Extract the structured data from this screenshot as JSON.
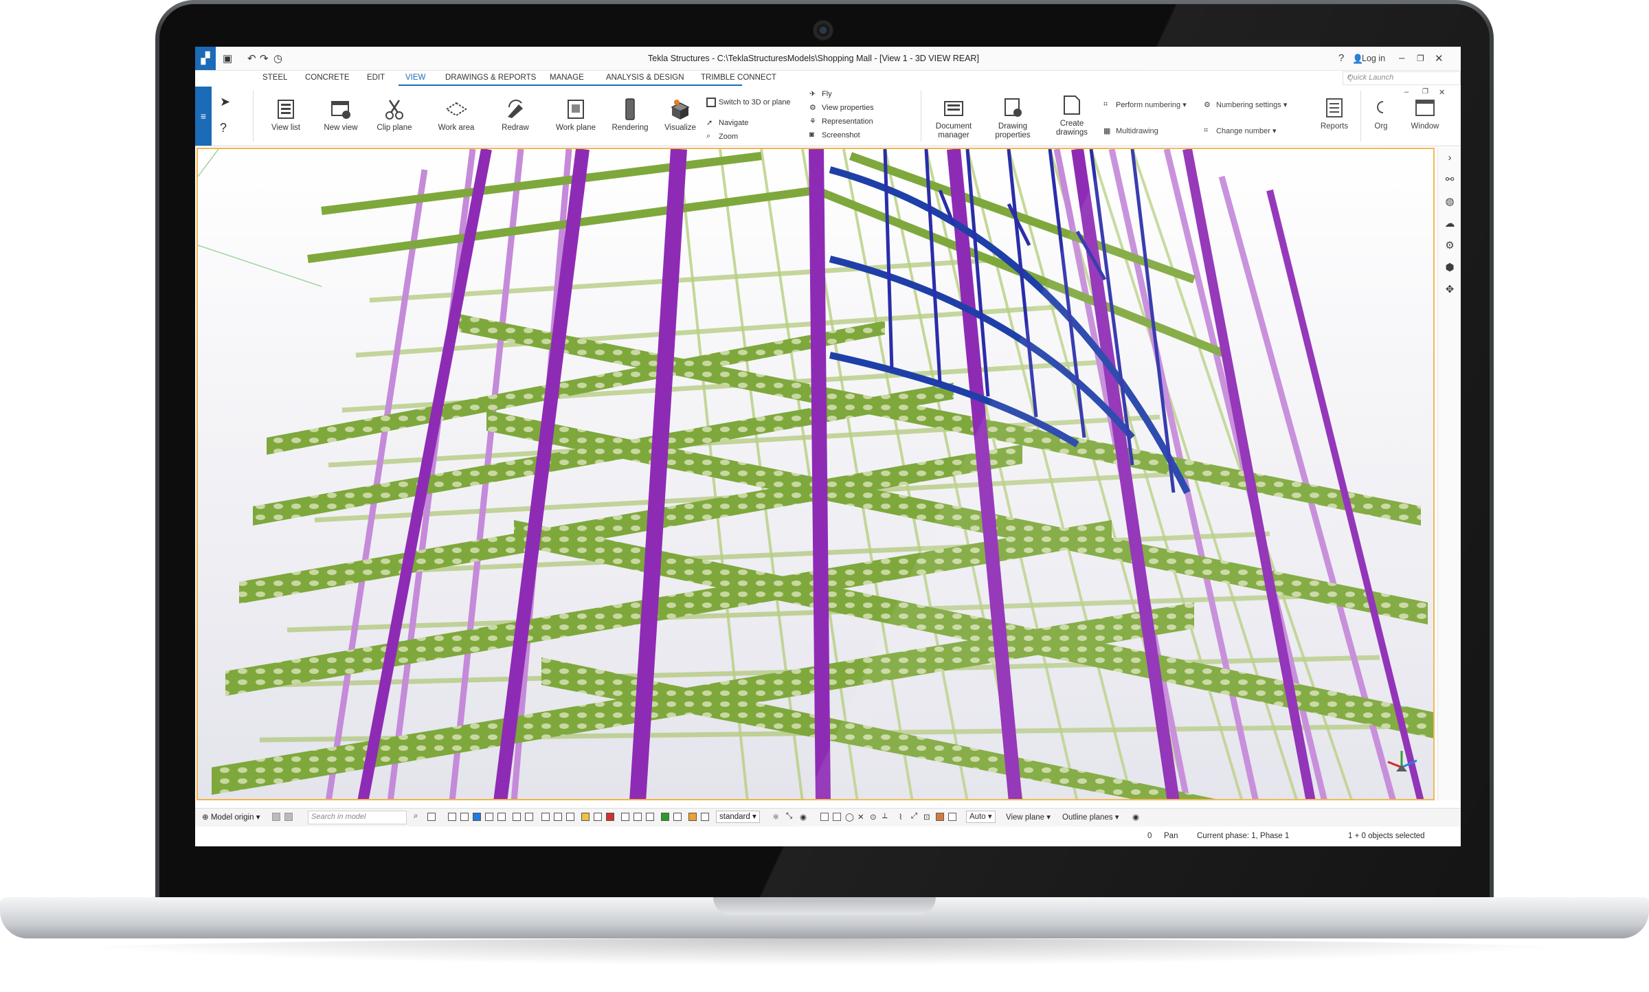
{
  "app": {
    "title": "Tekla Structures - C:\\TeklaStructuresModels\\Shopping Mall - [View 1 - 3D VIEW REAR]",
    "login_label": "Log in",
    "help_icon": "help-icon",
    "colors": {
      "accent": "#1b6bb7",
      "viewport_border": "#f2b54a",
      "beam_green": "#7ea83c",
      "column_purple": "#8e2bb5",
      "steel_blue": "#1f3fa8"
    }
  },
  "tabs": [
    {
      "label": "STEEL"
    },
    {
      "label": "CONCRETE"
    },
    {
      "label": "EDIT"
    },
    {
      "label": "VIEW",
      "active": true
    },
    {
      "label": "DRAWINGS & REPORTS"
    },
    {
      "label": "MANAGE"
    },
    {
      "label": "ANALYSIS & DESIGN"
    },
    {
      "label": "TRIMBLE CONNECT"
    }
  ],
  "quick_launch": {
    "placeholder": "Quick Launch"
  },
  "ribbon": {
    "large_buttons": [
      {
        "label": "View list",
        "icon": "view-list-icon"
      },
      {
        "label": "New view",
        "icon": "new-view-icon"
      },
      {
        "label": "Clip plane",
        "icon": "scissors-icon"
      },
      {
        "label": "Work area",
        "icon": "work-area-icon"
      },
      {
        "label": "Redraw",
        "icon": "redraw-icon"
      },
      {
        "label": "Work plane",
        "icon": "work-plane-icon"
      },
      {
        "label": "Rendering",
        "icon": "rendering-icon"
      },
      {
        "label": "Visualize",
        "icon": "visualize-icon"
      }
    ],
    "small_buttons": [
      {
        "label": "Switch to 3D or plane"
      },
      {
        "label": "Navigate"
      },
      {
        "label": "Zoom"
      },
      {
        "label": "Fly"
      },
      {
        "label": "View properties"
      },
      {
        "label": "Representation"
      },
      {
        "label": "Screenshot"
      }
    ],
    "drawing_buttons": [
      {
        "label": "Document manager"
      },
      {
        "label": "Drawing properties"
      },
      {
        "label": "Create drawings"
      }
    ],
    "numbering_buttons": [
      {
        "label": "Perform numbering"
      },
      {
        "label": "Multidrawing"
      },
      {
        "label": "Numbering settings"
      },
      {
        "label": "Change number"
      }
    ],
    "right_buttons": [
      {
        "label": "Reports"
      },
      {
        "label": "Org"
      },
      {
        "label": "Window"
      }
    ]
  },
  "right_toolbar_icons": [
    "chevron-right-icon",
    "link-icon",
    "globe-icon",
    "cloud-icon",
    "gear-icon",
    "cube-icon",
    "shapes-icon"
  ],
  "bottom_toolbar": {
    "model_origin": "Model origin",
    "search_placeholder": "Search in model",
    "standard": "standard",
    "auto": "Auto",
    "view_plane": "View plane",
    "outline_planes": "Outline planes"
  },
  "status_bar": {
    "value": "0",
    "mode": "Pan",
    "phase": "Current phase: 1, Phase 1",
    "selection": "1 + 0 objects selected"
  }
}
